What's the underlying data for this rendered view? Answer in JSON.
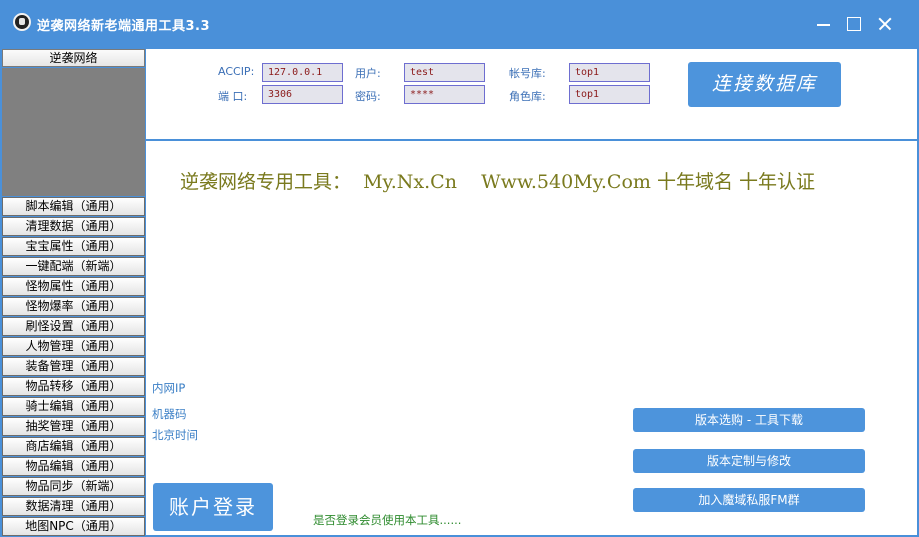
{
  "window": {
    "title": "逆袭网络新老端通用工具3.3",
    "icon": "app-logo-icon"
  },
  "sidebar": {
    "header": "逆袭网络",
    "items": [
      "脚本编辑（通用）",
      "清理数据（通用）",
      "宝宝属性（通用）",
      "一键配端（新端）",
      "怪物属性（通用）",
      "怪物爆率（通用）",
      "刷怪设置（通用）",
      "人物管理（通用）",
      "装备管理（通用）",
      "物品转移（通用）",
      "骑士编辑（通用）",
      "抽奖管理（通用）",
      "商店编辑（通用）",
      "物品编辑（通用）",
      "物品同步（新端）",
      "数据清理（通用）",
      "地图NPC（通用）"
    ]
  },
  "db": {
    "accip_label": "ACCIP:",
    "accip_value": "127.0.0.1",
    "port_label": "端 口:",
    "port_value": "3306",
    "user_label": "用户:",
    "user_value": "test",
    "password_label": "密码:",
    "password_value": "****",
    "account_db_label": "帐号库:",
    "account_db_value": "top1",
    "role_db_label": "角色库:",
    "role_db_value": "top1",
    "connect_label": "连接数据库"
  },
  "main": {
    "banner": "逆袭网络专用工具：  My.Nx.Cn    Www.540My.Com 十年域名 十年认证",
    "intranet_ip_label": "内网IP",
    "machine_code_label": "机器码",
    "beijing_time_label": "北京时间",
    "login_label": "账户登录",
    "login_hint": "是否登录会员使用本工具......",
    "version_button": "版本选购 - 工具下载",
    "custom_button": "版本定制与修改",
    "join_button": "加入魔域私服FM群"
  },
  "colors": {
    "accent": "#4a90d9",
    "banner_text": "#7a7a1e",
    "field_text": "#8b1a1a",
    "hint_text": "#2e8b2e"
  }
}
